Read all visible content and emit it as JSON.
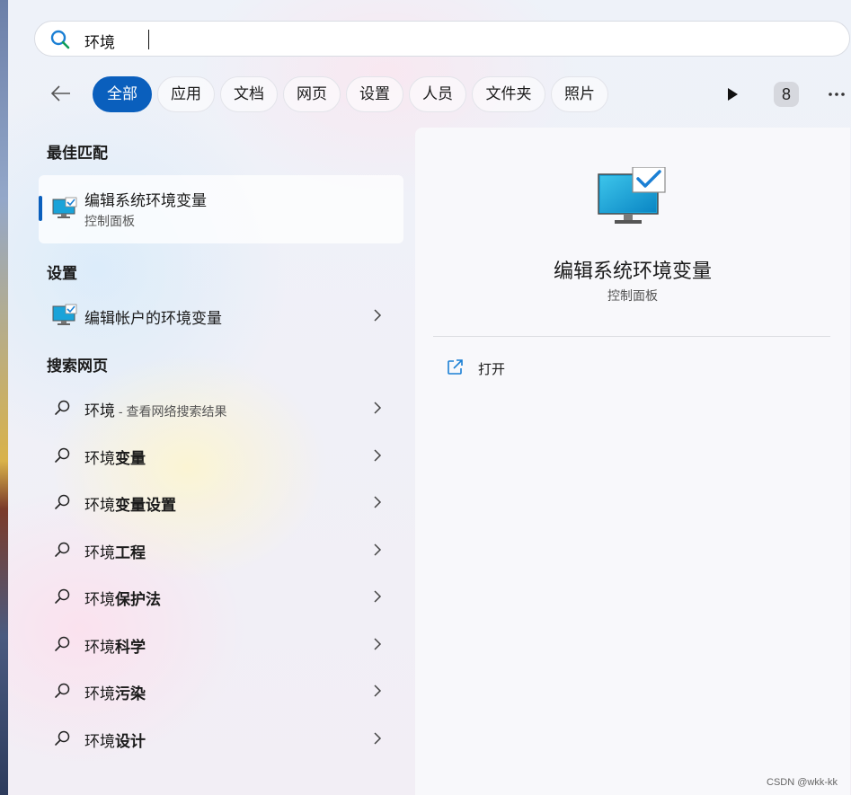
{
  "search": {
    "query": "环境"
  },
  "filters": {
    "items": [
      {
        "label": "全部",
        "active": true
      },
      {
        "label": "应用"
      },
      {
        "label": "文档"
      },
      {
        "label": "网页"
      },
      {
        "label": "设置"
      },
      {
        "label": "人员"
      },
      {
        "label": "文件夹"
      },
      {
        "label": "照片"
      }
    ],
    "badge": "8"
  },
  "best_match": {
    "heading": "最佳匹配",
    "title": "编辑系统环境变量",
    "subtitle": "控制面板"
  },
  "settings": {
    "heading": "设置",
    "item": "编辑帐户的环境变量"
  },
  "web": {
    "heading": "搜索网页",
    "first": {
      "prefix": "环境",
      "hint": " - 查看网络搜索结果"
    },
    "items": [
      {
        "prefix": "环境",
        "bold": "变量"
      },
      {
        "prefix": "环境",
        "bold": "变量设置"
      },
      {
        "prefix": "环境",
        "bold": "工程"
      },
      {
        "prefix": "环境",
        "bold": "保护法"
      },
      {
        "prefix": "环境",
        "bold": "科学"
      },
      {
        "prefix": "环境",
        "bold": "污染"
      },
      {
        "prefix": "环境",
        "bold": "设计"
      }
    ]
  },
  "preview": {
    "title": "编辑系统环境变量",
    "subtitle": "控制面板",
    "open_label": "打开"
  },
  "watermark": "CSDN @wkk-kk",
  "colors": {
    "accent": "#0a5fbd",
    "search_icon": "#1a7fd4"
  }
}
